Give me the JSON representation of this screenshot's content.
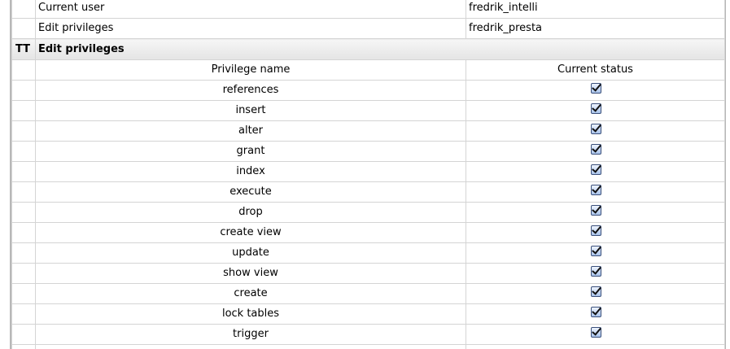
{
  "info_rows": [
    {
      "label": "Current user",
      "value": "fredrik_intelli"
    },
    {
      "label": "Edit privileges",
      "value": "fredrik_presta"
    }
  ],
  "section": {
    "tt_label": "TT",
    "title": "Edit privileges"
  },
  "columns": {
    "name": "Privilege name",
    "status": "Current status"
  },
  "privileges": [
    {
      "name": "references",
      "checked": true
    },
    {
      "name": "insert",
      "checked": true
    },
    {
      "name": "alter",
      "checked": true
    },
    {
      "name": "grant",
      "checked": true
    },
    {
      "name": "index",
      "checked": true
    },
    {
      "name": "execute",
      "checked": true
    },
    {
      "name": "drop",
      "checked": true
    },
    {
      "name": "create view",
      "checked": true
    },
    {
      "name": "update",
      "checked": true
    },
    {
      "name": "show view",
      "checked": true
    },
    {
      "name": "create",
      "checked": true
    },
    {
      "name": "lock tables",
      "checked": true
    },
    {
      "name": "trigger",
      "checked": true
    }
  ]
}
